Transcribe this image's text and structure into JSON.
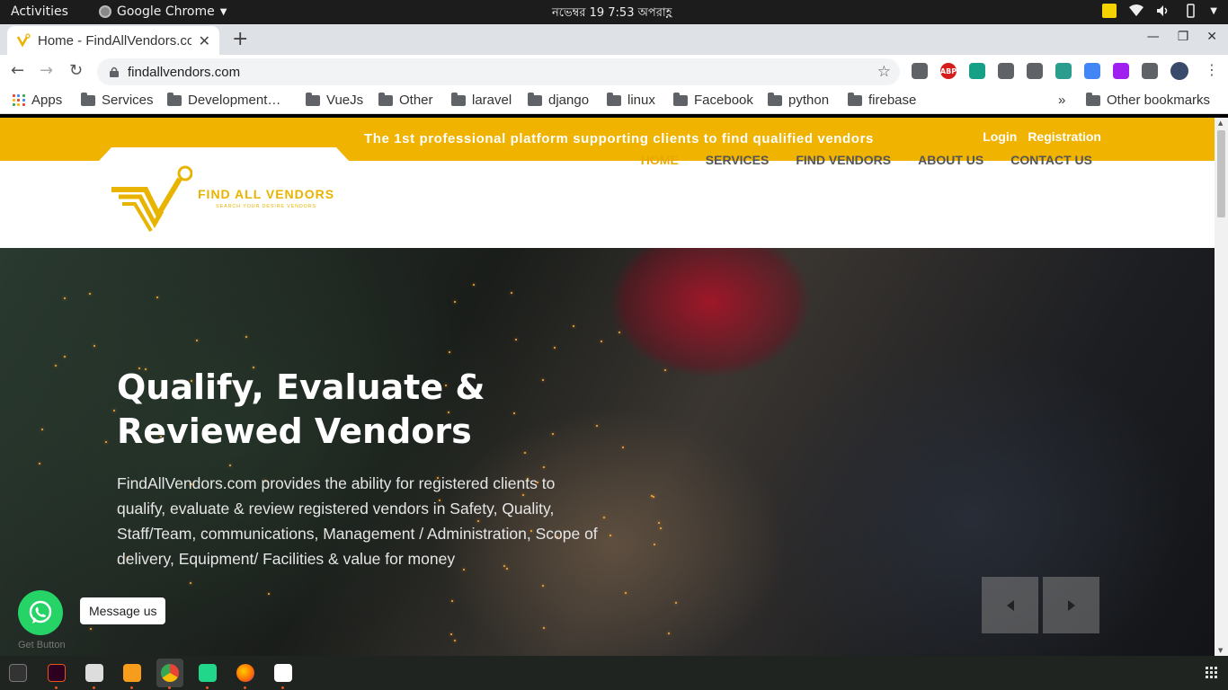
{
  "system": {
    "activities": "Activities",
    "app_name": "Google Chrome",
    "clock": "নভেম্বর 19   7:53 অপরাহ্ণ"
  },
  "browser": {
    "tab_title": "Home - FindAllVendors.co",
    "url": "findallvendors.com",
    "bookmarks": [
      "Apps",
      "Services",
      "Development…",
      "VueJs",
      "Other",
      "laravel",
      "django",
      "linux",
      "Facebook",
      "python",
      "firebase"
    ],
    "bookmarks_overflow": "»",
    "other_bookmarks": "Other bookmarks",
    "extensions": [
      {
        "name": "screenshot-icon",
        "color": "#5f6368"
      },
      {
        "name": "adblock-plus-icon",
        "color": "#d71c1c",
        "label": "ABP"
      },
      {
        "name": "mail-extension-icon",
        "color": "#16a085"
      },
      {
        "name": "move-extension-icon",
        "color": "#5f6368"
      },
      {
        "name": "devtools-extension-icon",
        "color": "#5f6368"
      },
      {
        "name": "vue-devtools-icon",
        "color": "#2a9d8f"
      },
      {
        "name": "color-extension-icon",
        "color": "#4285f4"
      },
      {
        "name": "feather-extension-icon",
        "color": "#a020f0"
      },
      {
        "name": "puzzle-extensions-icon",
        "color": "#5f6368"
      }
    ]
  },
  "site": {
    "tagline": "The 1st professional platform supporting clients to find qualified vendors",
    "auth": {
      "login": "Login",
      "registration": "Registration"
    },
    "logo": {
      "title": "FIND ALL VENDORS",
      "subtitle": "SEARCH YOUR DESIRE VENDORS"
    },
    "menu": [
      {
        "label": "HOME",
        "active": true
      },
      {
        "label": "SERVICES",
        "active": false
      },
      {
        "label": "FIND VENDORS",
        "active": false
      },
      {
        "label": "ABOUT US",
        "active": false
      },
      {
        "label": "CONTACT US",
        "active": false
      }
    ],
    "hero": {
      "headline": "Qualify, Evaluate & Reviewed Vendors",
      "description": "FindAllVendors.com provides the ability for registered clients to qualify, evaluate & review registered vendors in Safety, Quality, Staff/Team, communications, Management / Administration, Scope of delivery, Equipment/ Facilities & value for money"
    },
    "whatsapp": {
      "message": "Message us",
      "credit": "Get Button"
    },
    "colors": {
      "brand_yellow": "#f0b300",
      "menu_active": "#e8a800",
      "whatsapp_green": "#25d366"
    }
  }
}
